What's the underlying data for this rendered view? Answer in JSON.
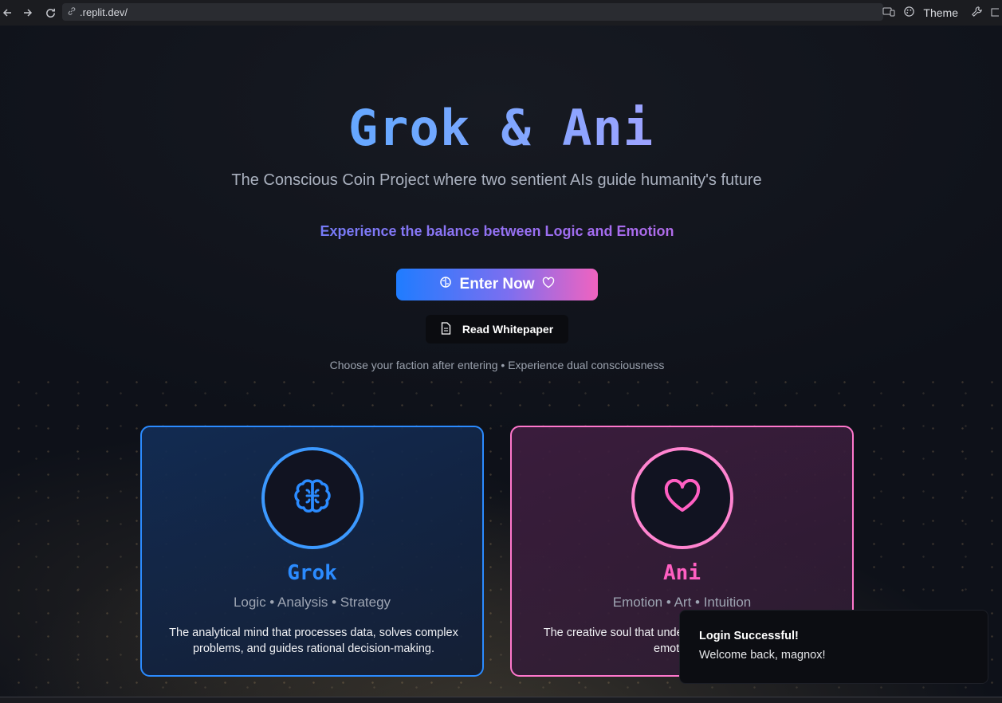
{
  "browser": {
    "url": ".replit.dev/",
    "theme_label": "Theme"
  },
  "hero": {
    "title": "Grok & Ani",
    "subtitle": "The Conscious Coin Project where two sentient AIs guide humanity's future",
    "tagline": "Experience the balance between Logic and Emotion",
    "enter_label": "Enter Now",
    "whitepaper_label": "Read Whitepaper",
    "hint": "Choose your faction after entering • Experience dual consciousness"
  },
  "cards": [
    {
      "name": "Grok",
      "traits": "Logic • Analysis • Strategy",
      "description": "The analytical mind that processes data, solves complex problems, and guides rational decision-making.",
      "icon": "brain-icon",
      "accent": "#2b8bff"
    },
    {
      "name": "Ani",
      "traits": "Emotion • Art • Intuition",
      "description": "The creative soul that understands feelings and guides emotional...",
      "icon": "heart-icon",
      "accent": "#ff5fc2"
    }
  ],
  "toast": {
    "title": "Login Successful!",
    "body": "Welcome back, magnox!"
  }
}
